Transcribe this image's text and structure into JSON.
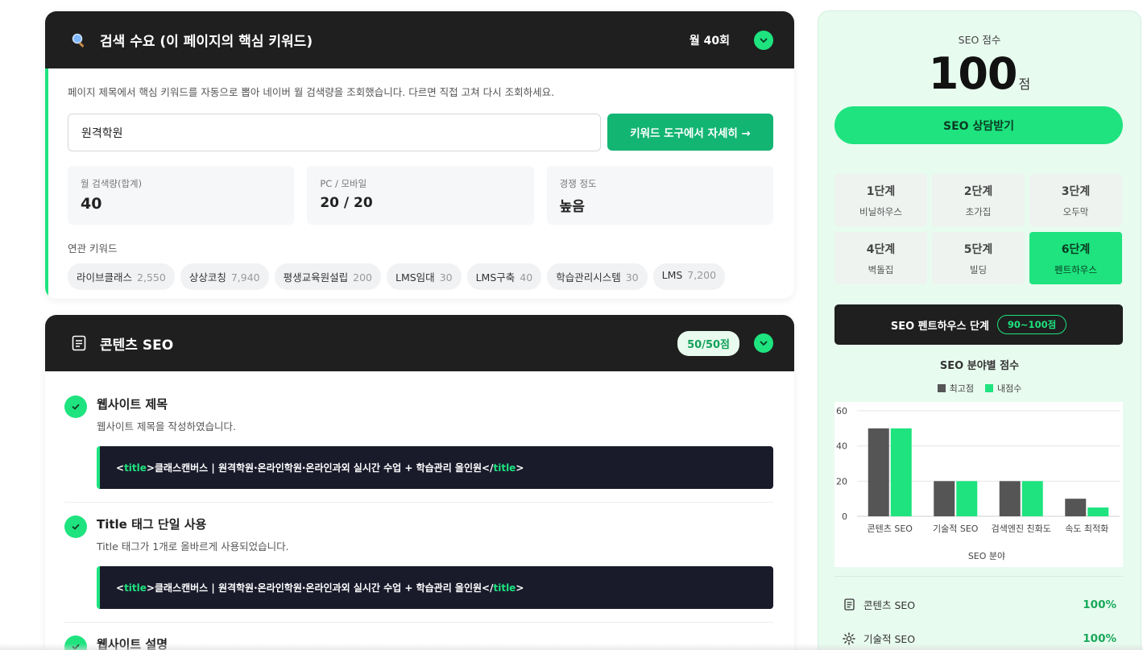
{
  "search_demand": {
    "title": "검색 수요 (이 페이지의 핵심 키워드)",
    "monthly_badge": "월 40회",
    "description": "페이지 제목에서 핵심 키워드를 자동으로 뽑아 네이버 월 검색량을 조회했습니다. 다르면 직접 고쳐 다시 조회하세요.",
    "keyword_value": "원격학원",
    "tool_button": "키워드 도구에서 자세히 →",
    "stats": [
      {
        "label": "월 검색량(합계)",
        "value": "40"
      },
      {
        "label": "PC / 모바일",
        "value": "20 / 20"
      },
      {
        "label": "경쟁 정도",
        "value": "높음"
      }
    ],
    "related_label": "연관 키워드",
    "related": [
      {
        "name": "라이브클래스",
        "count": "2,550"
      },
      {
        "name": "상상코칭",
        "count": "7,940"
      },
      {
        "name": "평생교육원설립",
        "count": "200"
      },
      {
        "name": "LMS임대",
        "count": "30"
      },
      {
        "name": "LMS구축",
        "count": "40"
      },
      {
        "name": "학습관리시스템",
        "count": "30"
      },
      {
        "name": "LMS",
        "count": "7,200"
      }
    ]
  },
  "content_seo": {
    "title": "콘텐츠 SEO",
    "score": "50/50점",
    "items": [
      {
        "title": "웹사이트 제목",
        "desc": "웹사이트 제목을 작성하였습니다.",
        "code_open": "<",
        "code_tag": "title",
        "code_mid": ">클래스캔버스 | 원격학원·온라인학원·온라인과외 실시간 수업 + 학습관리 올인원</",
        "code_close": ">"
      },
      {
        "title": "Title 태그 단일 사용",
        "desc": "Title 태그가 1개로 올바르게 사용되었습니다.",
        "code_open": "<",
        "code_tag": "title",
        "code_mid": ">클래스캔버스 | 원격학원·온라인학원·온라인과외 실시간 수업 + 학습관리 올인원</",
        "code_close": ">"
      },
      {
        "title": "웹사이트 설명"
      }
    ]
  },
  "sidebar": {
    "score_label": "SEO 점수",
    "score": "100",
    "score_unit": "점",
    "consult_button": "SEO 상담받기",
    "stages": [
      {
        "num": "1단계",
        "name": "비닐하우스"
      },
      {
        "num": "2단계",
        "name": "초가집"
      },
      {
        "num": "3단계",
        "name": "오두막"
      },
      {
        "num": "4단계",
        "name": "벽돌집"
      },
      {
        "num": "5단계",
        "name": "빌딩"
      },
      {
        "num": "6단계",
        "name": "펜트하우스"
      }
    ],
    "active_stage": 6,
    "tier_label": "SEO 펜트하우스 단계",
    "tier_range": "90~100점",
    "categories": [
      {
        "icon": "document-icon",
        "label": "콘텐츠 SEO",
        "percent": "100%"
      },
      {
        "icon": "gear-icon",
        "label": "기술적 SEO",
        "percent": "100%"
      }
    ]
  },
  "chart_data": {
    "type": "bar",
    "title": "SEO 분야별 점수",
    "xlabel": "SEO 분야",
    "ylabel": "",
    "categories": [
      "콘텐츠 SEO",
      "기술적 SEO",
      "검색엔진 친화도",
      "속도 최적화"
    ],
    "series": [
      {
        "name": "최고점",
        "values": [
          50,
          20,
          20,
          10
        ],
        "color": "#555555"
      },
      {
        "name": "내점수",
        "values": [
          50,
          20,
          20,
          5
        ],
        "color": "#1ee37f"
      }
    ],
    "ylim": [
      0,
      60
    ],
    "yticks": [
      0,
      20,
      40,
      60
    ],
    "legend": "top",
    "grid": true
  },
  "colors": {
    "accent": "#1ee37f",
    "dark": "#1f1f1f",
    "code_bg": "#191b2b",
    "button_green": "#13b573"
  }
}
